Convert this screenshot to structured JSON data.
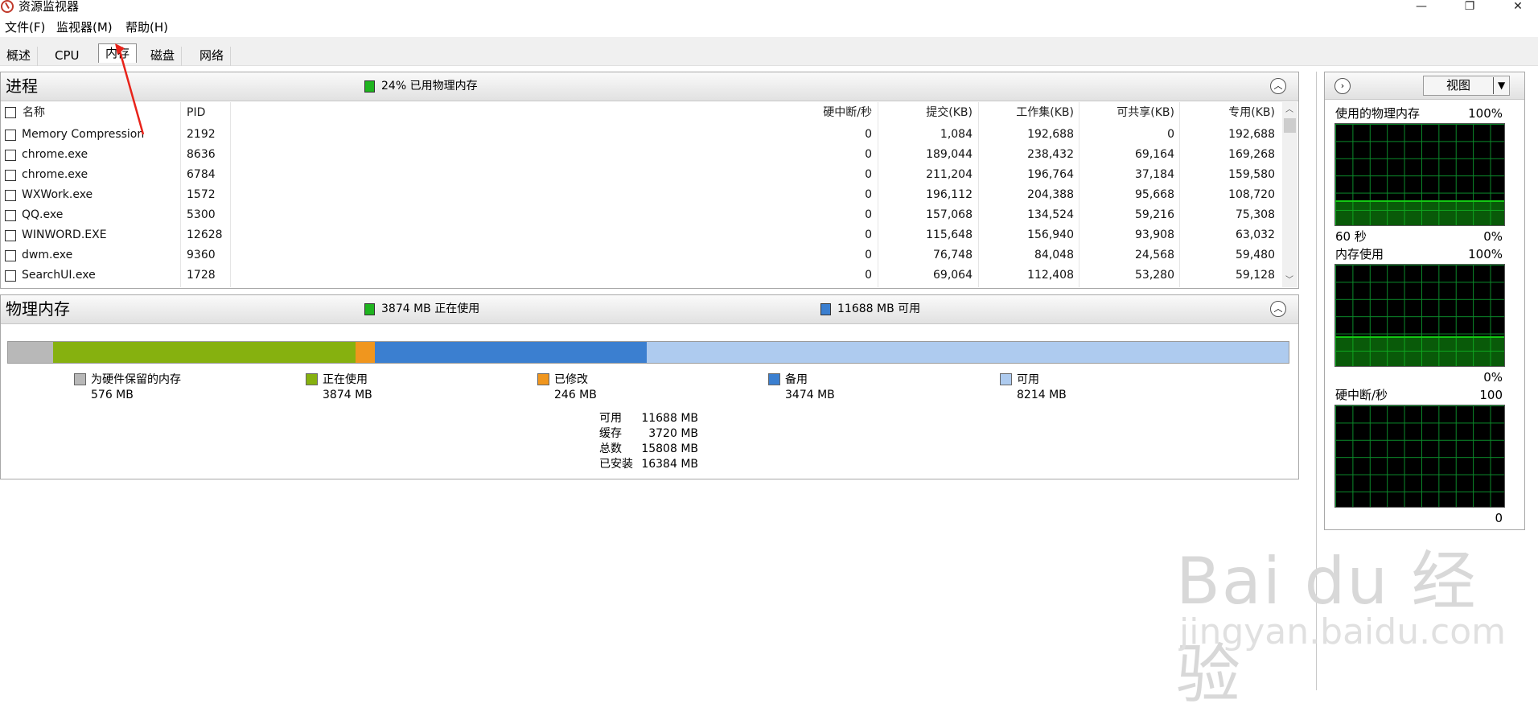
{
  "window": {
    "title": "资源监视器",
    "controls": {
      "minimize": "—",
      "restore": "❐",
      "close": "✕"
    }
  },
  "menu": [
    "文件(F)",
    "监视器(M)",
    "帮助(H)"
  ],
  "tabs": [
    "概述",
    "CPU",
    "内存",
    "磁盘",
    "网络"
  ],
  "active_tab": "内存",
  "processes": {
    "title": "进程",
    "summary": "24% 已用物理内存",
    "columns": [
      "名称",
      "PID",
      "硬中断/秒",
      "提交(KB)",
      "工作集(KB)",
      "可共享(KB)",
      "专用(KB)"
    ],
    "rows": [
      [
        "Memory Compression",
        "2192",
        "0",
        "1,084",
        "192,688",
        "0",
        "192,688"
      ],
      [
        "chrome.exe",
        "8636",
        "0",
        "189,044",
        "238,432",
        "69,164",
        "169,268"
      ],
      [
        "chrome.exe",
        "6784",
        "0",
        "211,204",
        "196,764",
        "37,184",
        "159,580"
      ],
      [
        "WXWork.exe",
        "1572",
        "0",
        "196,112",
        "204,388",
        "95,668",
        "108,720"
      ],
      [
        "QQ.exe",
        "5300",
        "0",
        "157,068",
        "134,524",
        "59,216",
        "75,308"
      ],
      [
        "WINWORD.EXE",
        "12628",
        "0",
        "115,648",
        "156,940",
        "93,908",
        "63,032"
      ],
      [
        "dwm.exe",
        "9360",
        "0",
        "76,748",
        "84,048",
        "24,568",
        "59,480"
      ],
      [
        "SearchUI.exe",
        "1728",
        "0",
        "69,064",
        "112,408",
        "53,280",
        "59,128"
      ]
    ]
  },
  "physical_memory": {
    "title": "物理内存",
    "in_use_summary": "3874 MB 正在使用",
    "available_summary": "11688 MB 可用",
    "segments": [
      {
        "label": "为硬件保留的内存",
        "value": "576 MB",
        "mb": 576,
        "color": "#b8b8b8"
      },
      {
        "label": "正在使用",
        "value": "3874 MB",
        "mb": 3874,
        "color": "#86b10f"
      },
      {
        "label": "已修改",
        "value": "246 MB",
        "mb": 246,
        "color": "#f0961e"
      },
      {
        "label": "备用",
        "value": "3474 MB",
        "mb": 3474,
        "color": "#3b7fd0"
      },
      {
        "label": "可用",
        "value": "8214 MB",
        "mb": 8214,
        "color": "#aecbef"
      }
    ],
    "stats": [
      {
        "label": "可用",
        "value": "11688 MB"
      },
      {
        "label": "缓存",
        "value": "3720 MB"
      },
      {
        "label": "总数",
        "value": "15808 MB"
      },
      {
        "label": "已安装",
        "value": "16384 MB"
      }
    ]
  },
  "side_panel": {
    "view_button": "视图",
    "graphs": [
      {
        "title": "使用的物理内存",
        "max": "100%",
        "time": "60 秒",
        "min": "0%",
        "level": 0.24
      },
      {
        "title": "内存使用",
        "max": "100%",
        "time": "",
        "min": "0%",
        "level": 0.29
      },
      {
        "title": "硬中断/秒",
        "max": "100",
        "time": "",
        "min": "0",
        "level": 0.0
      }
    ]
  },
  "watermark": {
    "logo": "Bai du 经验",
    "url": "jingyan.baidu.com"
  },
  "colors": {
    "in_use_green": "#1fb41f",
    "available_blue": "#3b7fd0",
    "graph_green": "#0b8a2a",
    "graph_fill": "#14c814"
  }
}
